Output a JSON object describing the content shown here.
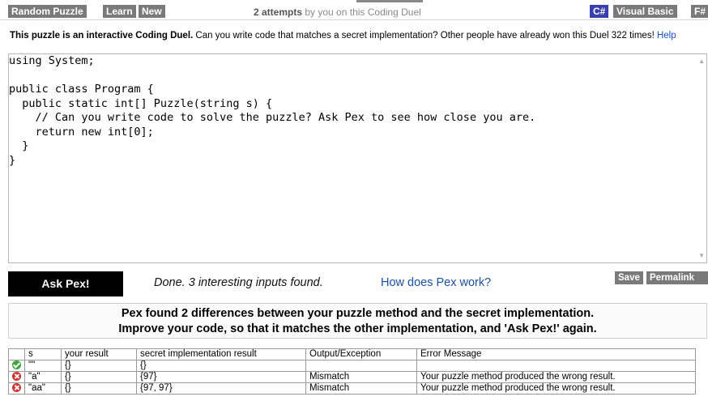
{
  "topbar": {
    "random_puzzle": "Random Puzzle",
    "learn": "Learn",
    "new": "New",
    "attempts_bold": "2 attempts",
    "attempts_rest": " by you on this Coding Duel",
    "languages": [
      "C#",
      "Visual Basic",
      "F#"
    ],
    "active_language": "C#"
  },
  "intro": {
    "bold": "This puzzle is an interactive Coding Duel.",
    "text": " Can you write code that matches a secret implementation? Other people have already won this Duel 322 times!",
    "help": "Help"
  },
  "editor": {
    "code": "using System;\n\npublic class Program {\n  public static int[] Puzzle(string s) {\n    // Can you write code to solve the puzzle? Ask Pex to see how close you are.\n    return new int[0];\n  }\n}"
  },
  "actions": {
    "ask_pex": "Ask Pex!",
    "status": "Done. 3 interesting inputs found.",
    "how_link": "How does Pex work?",
    "save": "Save",
    "permalink": "Permalink"
  },
  "banner": {
    "line1": "Pex found 2 differences between your puzzle method and the secret implementation.",
    "line2": "Improve your code, so that it matches the other implementation, and 'Ask Pex!' again."
  },
  "results": {
    "headers": [
      "",
      "s",
      "your result",
      "secret implementation result",
      "Output/Exception",
      "Error Message"
    ],
    "rows": [
      {
        "status": "pass",
        "s": "\"\"",
        "your_result": "{}",
        "secret_result": "{}",
        "output": "",
        "error": ""
      },
      {
        "status": "fail",
        "s": "\"a\"",
        "your_result": "{}",
        "secret_result": "{97}",
        "output": "Mismatch",
        "error": "Your puzzle method produced the wrong result."
      },
      {
        "status": "fail",
        "s": "\"aa\"",
        "your_result": "{}",
        "secret_result": "{97, 97}",
        "output": "Mismatch",
        "error": "Your puzzle method produced the wrong result."
      }
    ]
  },
  "colors": {
    "active_tab": "#3a3fae",
    "button_gray": "#7a7a7a",
    "link_blue": "#1a4fa8",
    "pass_green": "#3ca53c",
    "fail_red": "#d23535"
  }
}
